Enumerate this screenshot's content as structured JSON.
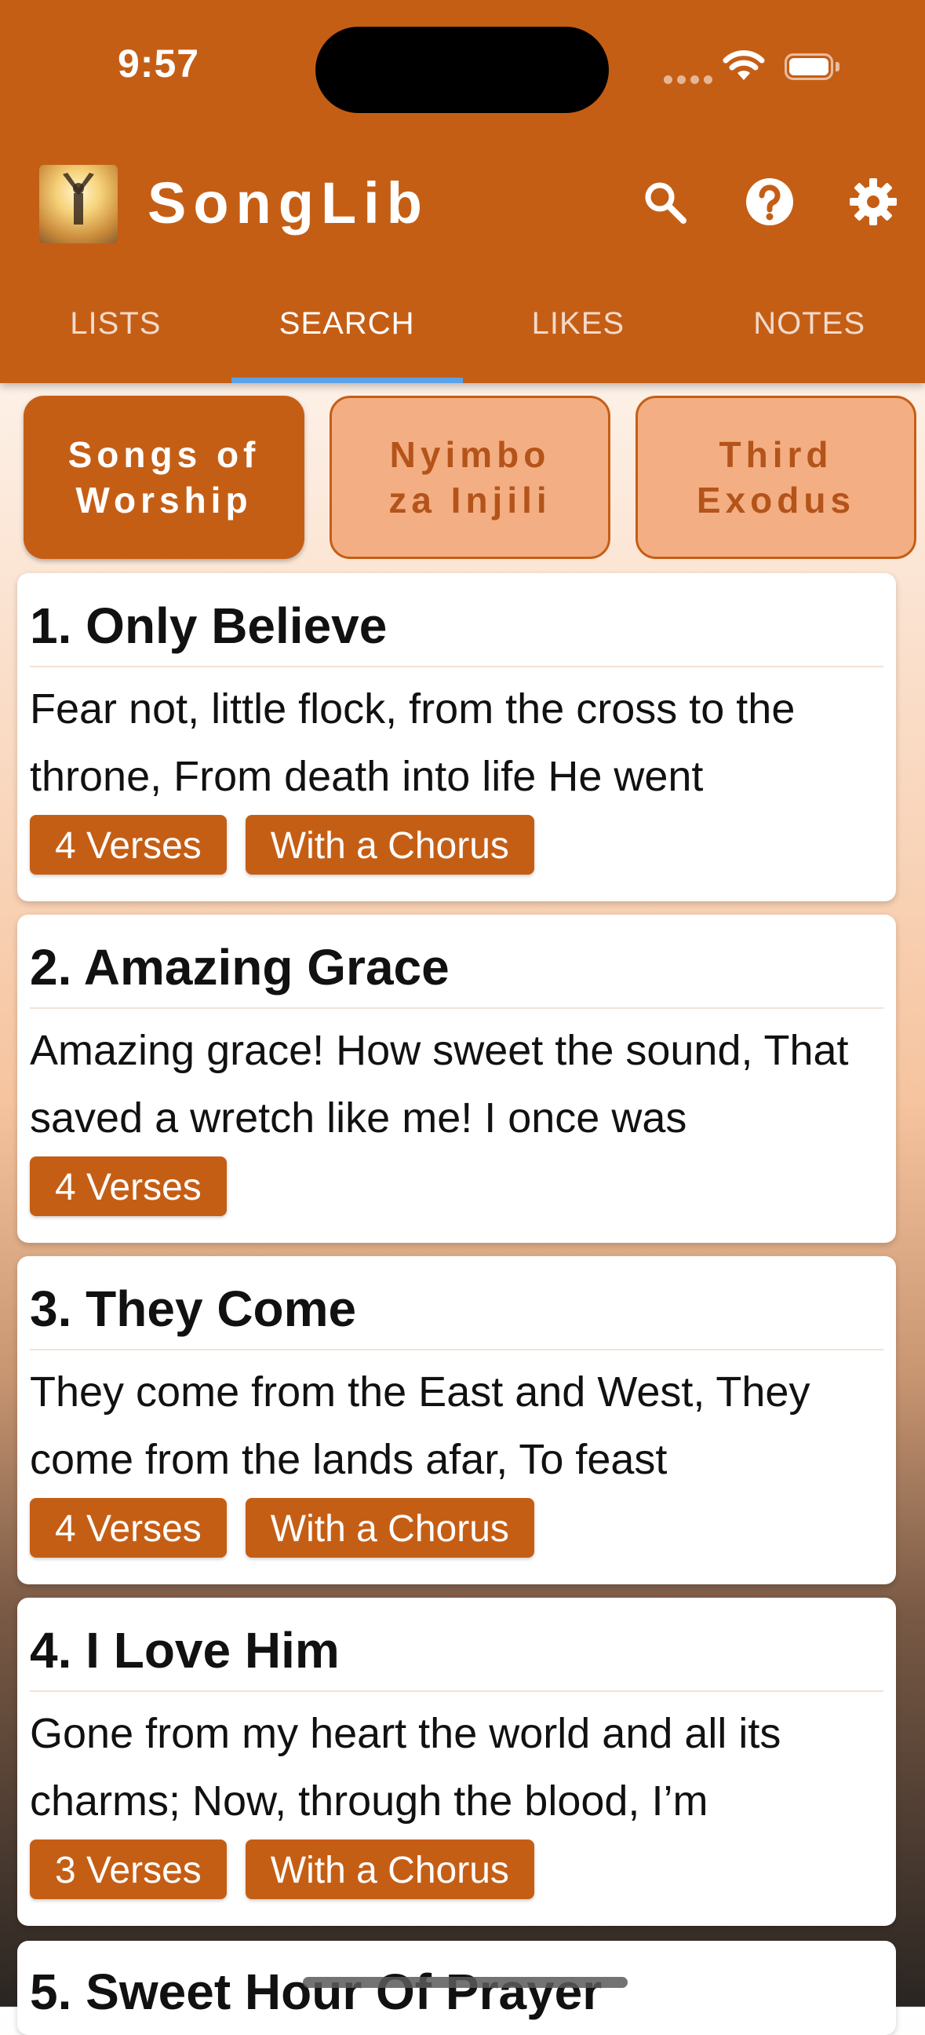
{
  "status_bar": {
    "time": "9:57"
  },
  "app": {
    "title": "SongLib"
  },
  "header_icons": [
    "search-icon",
    "help-icon",
    "settings-icon"
  ],
  "tabs": [
    {
      "label": "LISTS",
      "active": false
    },
    {
      "label": "SEARCH",
      "active": true
    },
    {
      "label": "LIKES",
      "active": false
    },
    {
      "label": "NOTES",
      "active": false
    }
  ],
  "books": [
    {
      "line1": "Songs of",
      "line2": "Worship",
      "selected": true
    },
    {
      "line1": "Nyimbo",
      "line2": "za Injili",
      "selected": false
    },
    {
      "line1": "Third",
      "line2": "Exodus",
      "selected": false
    }
  ],
  "songs": [
    {
      "title": "1. Only Believe",
      "excerpt": "Fear not, little flock, from the cross to the throne, From death into life He went",
      "verses": "4 Verses",
      "chorus": "With a Chorus"
    },
    {
      "title": "2. Amazing Grace",
      "excerpt": "Amazing grace! How sweet the sound, That saved a wretch like me! I once was",
      "verses": "4 Verses",
      "chorus": null
    },
    {
      "title": "3. They Come",
      "excerpt": "They come from the East and West, They come from the lands afar, To feast",
      "verses": "4 Verses",
      "chorus": "With a Chorus"
    },
    {
      "title": "4. I Love Him",
      "excerpt": "Gone from my heart the world and all its charms; Now, through the blood, I’m",
      "verses": "3 Verses",
      "chorus": "With a Chorus"
    },
    {
      "title": "5. Sweet Hour Of Prayer"
    }
  ],
  "colors": {
    "primary": "#c55e15",
    "chip_inactive": "#f3af83",
    "tab_indicator": "#5aa3e8"
  }
}
